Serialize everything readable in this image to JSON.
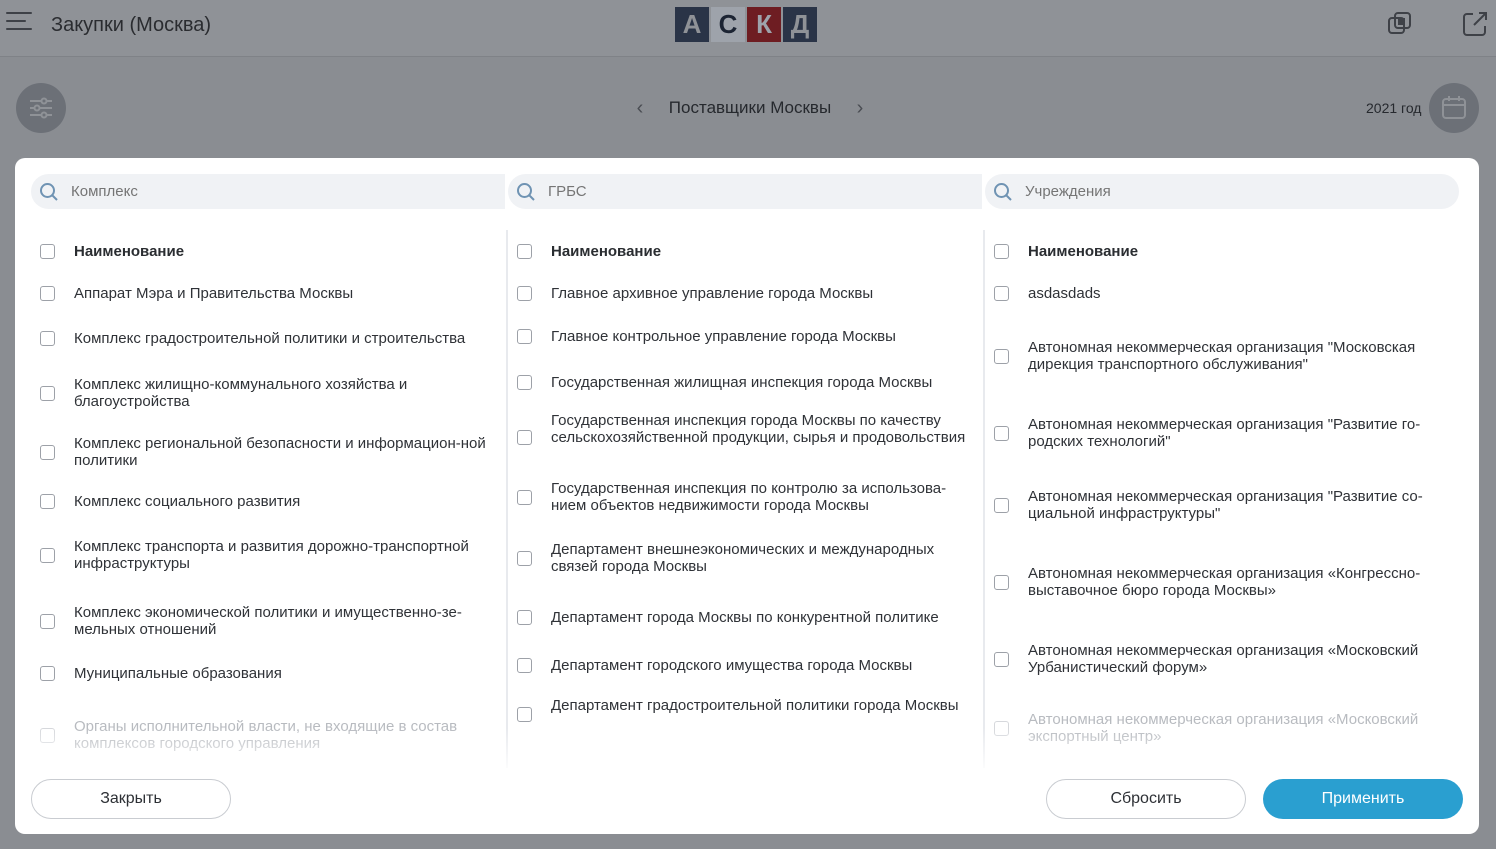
{
  "app": {
    "title": "Закупки (Москва)",
    "logo_letters": [
      "А",
      "С",
      "К",
      "Д"
    ]
  },
  "toolbar": {
    "section": "Поставщики Москвы",
    "year": "2021 год"
  },
  "colors": {
    "primary": "#2a9fd0",
    "overlay": "#8a8d92",
    "logo_red": "#6e1d22"
  },
  "columns": [
    {
      "search_placeholder": "Комплекс",
      "header": "Наименование",
      "items": [
        "Аппарат Мэра и Правительства Москвы",
        "Комплекс градостроительной политики и строительства",
        "Комплекс жилищно-коммунального хозяйства и благоустройства",
        "Комплекс региональной безопасности и информацион-ной политики",
        "Комплекс социального развития",
        "Комплекс транспорта и развития дорожно-транспортной инфраструктуры",
        "Комплекс экономической политики и имущественно-зе-мельных отношений",
        "Муниципальные образования",
        "Органы исполнительной власти, не входящие в состав комплексов городского управления"
      ]
    },
    {
      "search_placeholder": "ГРБС",
      "header": "Наименование",
      "items": [
        "Главное архивное управление города Москвы",
        "Главное контрольное управление города Москвы",
        "Государственная жилищная инспекция города Москвы",
        "Государственная инспекция города Москвы по качеству сельскохозяйственной продукции, сырья и продовольствия",
        "Государственная инспекция по контролю за использова-нием объектов недвижимости города Москвы",
        "Департамент внешнеэкономических и международных связей города Москвы",
        "Департамент города Москвы по конкурентной политике",
        "Департамент городского имущества города Москвы",
        "Департамент градостроительной политики города Москвы"
      ]
    },
    {
      "search_placeholder": "Учреждения",
      "header": "Наименование",
      "items": [
        "asdasdads",
        "Автономная некоммерческая организация \"Московская дирекция транспортного обслуживания\"",
        "Автономная некоммерческая организация \"Развитие го-родских технологий\"",
        "Автономная некоммерческая организация \"Развитие со-циальной инфраструктуры\"",
        "Автономная некоммерческая организация «Конгрессно-выставочное бюро города Москвы»",
        "Автономная некоммерческая организация «Московский Урбанистический форум»",
        "Автономная некоммерческая организация «Московский экспортный центр»"
      ]
    }
  ],
  "buttons": {
    "close": "Закрыть",
    "reset": "Сбросить",
    "apply": "Применить"
  }
}
